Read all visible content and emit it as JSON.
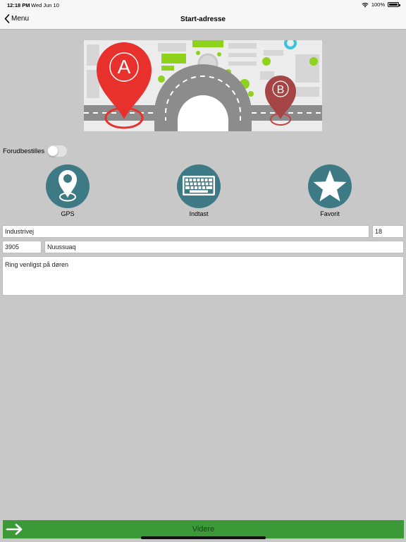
{
  "status": {
    "time": "12:18 PM",
    "date": "Wed Jun 10",
    "battery": "100%"
  },
  "nav": {
    "back_label": "Menu",
    "title": "Start-adresse"
  },
  "hero": {
    "pin_a": "A",
    "pin_b": "B"
  },
  "prebook": {
    "label": "Forudbestilles",
    "enabled": false
  },
  "options": [
    {
      "id": "gps",
      "label": "GPS",
      "icon": "location-pin-icon"
    },
    {
      "id": "manual",
      "label": "Indtast",
      "icon": "keyboard-icon"
    },
    {
      "id": "favorite",
      "label": "Favorit",
      "icon": "star-icon"
    }
  ],
  "address": {
    "street": "Industrivej",
    "number": "18",
    "zip": "3905",
    "city": "Nuussuaq",
    "note": "Ring venligst på døren"
  },
  "cta": {
    "label": "Videre"
  },
  "colors": {
    "accent": "#3d7a85",
    "cta": "#3b9a37",
    "pin_a": "#e8312c",
    "pin_b": "#a54545"
  }
}
